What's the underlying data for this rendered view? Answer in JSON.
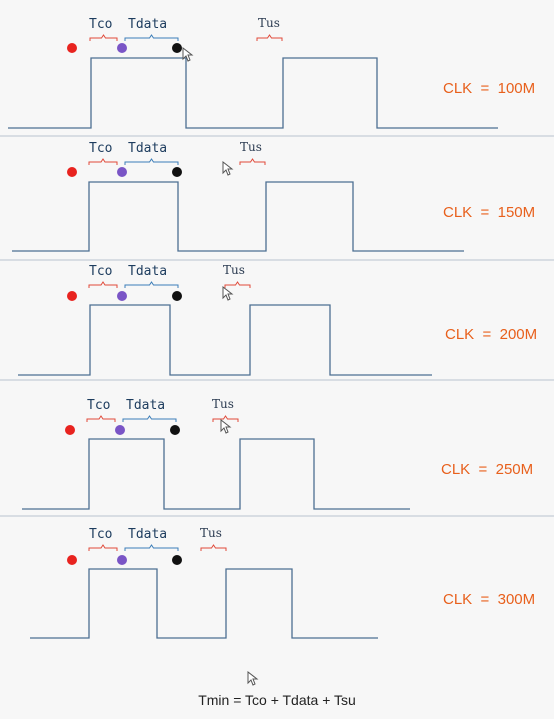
{
  "labels": {
    "tco": "Tco",
    "tdata": "Tdata",
    "tus": "Tus"
  },
  "panels": [
    {
      "clk": "CLK  =  100M"
    },
    {
      "clk": "CLK  =  150M"
    },
    {
      "clk": "CLK  =  200M"
    },
    {
      "clk": "CLK  =  250M"
    },
    {
      "clk": "CLK  =  300M"
    }
  ],
  "formula": "Tmin = Tco + Tdata + Tsu",
  "colors": {
    "red_dot": "#e8231f",
    "purple_dot": "#7a55c6",
    "black_dot": "#111111",
    "wave": "#4d6f92",
    "clk_text": "#e8601c"
  }
}
